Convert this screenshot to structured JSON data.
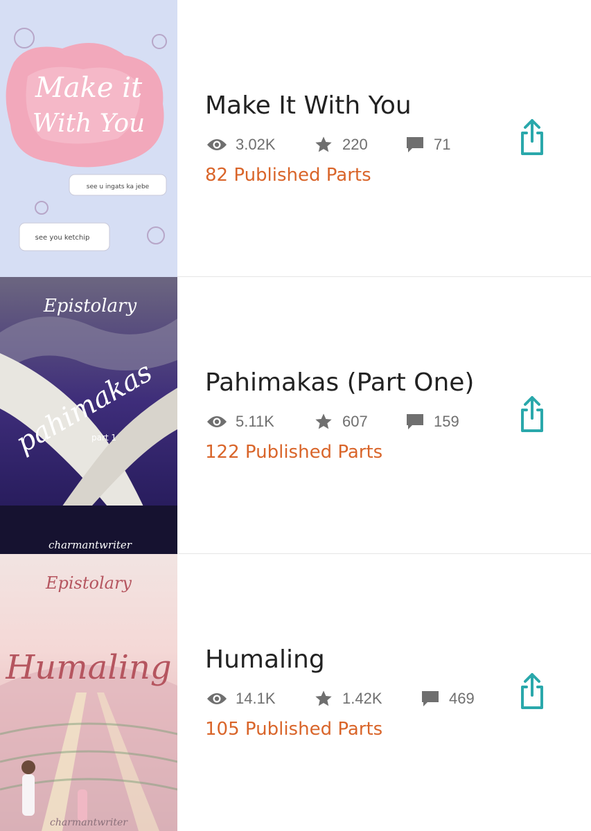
{
  "colors": {
    "accent": "#d9652a",
    "share": "#2aa8ab",
    "meta": "#6f6f6f"
  },
  "icons": {
    "reads": "eye-icon",
    "votes": "star-icon",
    "comments": "comment-icon",
    "share": "share-icon"
  },
  "stories": [
    {
      "title": "Make It With You",
      "reads": "3.02K",
      "votes": "220",
      "comments": "71",
      "parts": "82 Published Parts",
      "cover": {
        "title_line1": "Make it",
        "title_line2": "With You",
        "bubble1": "see u ingats ka jebe",
        "bubble2": "see you ketchip"
      }
    },
    {
      "title": "Pahimakas (Part One)",
      "reads": "5.11K",
      "votes": "607",
      "comments": "159",
      "parts": "122 Published Parts",
      "cover": {
        "series": "Epistolary",
        "title": "pahimakas",
        "subtitle": "part 1",
        "author": "charmantwriter"
      }
    },
    {
      "title": "Humaling",
      "reads": "14.1K",
      "votes": "1.42K",
      "comments": "469",
      "parts": "105 Published Parts",
      "cover": {
        "series": "Epistolary",
        "title": "Humaling",
        "author": "charmantwriter"
      }
    }
  ]
}
